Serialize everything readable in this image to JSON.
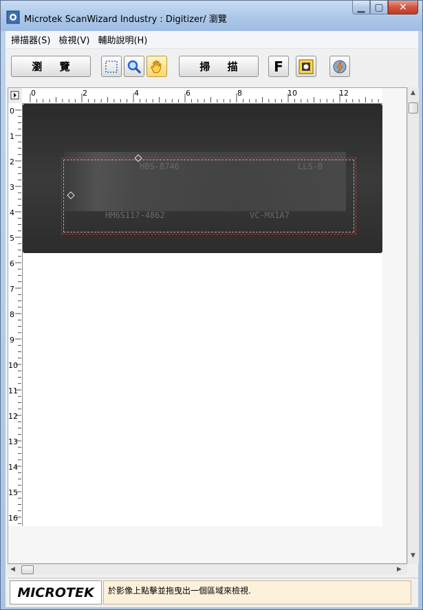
{
  "window": {
    "title": "Microtek ScanWizard Industry : Digitizer/ 瀏覽",
    "caption_buttons": {
      "minimize": "minimize",
      "maximize": "maximize",
      "close": "close"
    }
  },
  "menu": [
    {
      "label": "掃描器(S)"
    },
    {
      "label": "檢視(V)"
    },
    {
      "label": "輔助說明(H)"
    }
  ],
  "toolbar": {
    "preview_label": "瀏 覽",
    "scan_label": "掃 描",
    "f_label": "F",
    "icons": [
      "selection-tool-icon",
      "zoom-tool-icon",
      "hand-tool-icon",
      "settings-icon",
      "power-icon"
    ]
  },
  "rulers": {
    "top_labels": [
      "0",
      "2",
      "4",
      "6",
      "8",
      "10",
      "12"
    ],
    "left_labels": [
      "0",
      "1",
      "2",
      "3",
      "4",
      "5",
      "6",
      "7",
      "8",
      "9",
      "10",
      "11",
      "12",
      "13",
      "14",
      "15",
      "16"
    ]
  },
  "scan_text": {
    "line1_left": "HBS-8746",
    "line1_right": "LLS-0",
    "line2_left": "HM6S117-4862",
    "line2_right": "VC-MX1A7"
  },
  "status": {
    "logo": "MICROTEK",
    "message": "於影像上點擊並拖曳出一個區域來檢視."
  }
}
